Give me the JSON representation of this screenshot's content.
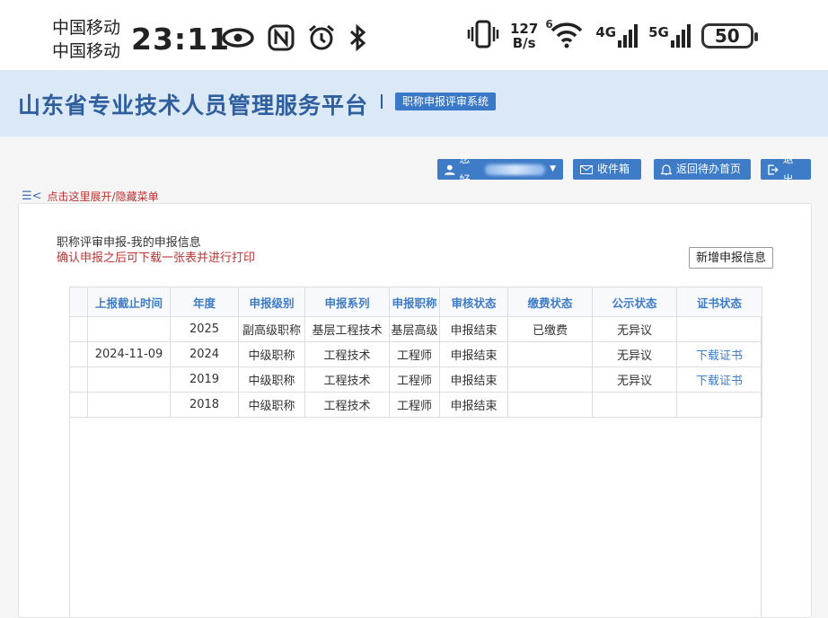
{
  "status_bar": {
    "carrier_1": "中国移动",
    "carrier_2": "中国移动",
    "time": "23:11",
    "speed_value": "127",
    "speed_unit": "B/s",
    "wifi_badge": "6",
    "net_1": "4G",
    "net_2": "5G",
    "battery": "50"
  },
  "header": {
    "title": "山东省专业技术人员管理服务平台",
    "system_badge": "职称申报评审系统"
  },
  "toolbar": {
    "user_label": "您好",
    "inbox_label": "收件箱",
    "todo_home_label": "返回待办首页",
    "logout_label": "退出",
    "toggle_menu_label": "点击这里展开/隐藏菜单",
    "toggle_menu_icon": "list-icon"
  },
  "main": {
    "info_title": "职称评审申报-我的申报信息",
    "info_note": "确认申报之后可下载一张表并进行打印",
    "add_button": "新增申报信息"
  },
  "table": {
    "headers": [
      "上报截止时间",
      "年度",
      "申报级别",
      "申报系列",
      "申报职称",
      "审核状态",
      "缴费状态",
      "公示状态",
      "证书状态"
    ],
    "rows": [
      [
        "",
        "2025",
        "副高级职称",
        "基层工程技术",
        "基层高级",
        "申报结束",
        "已缴费",
        "无异议",
        ""
      ],
      [
        "2024-11-09",
        "2024",
        "中级职称",
        "工程技术",
        "工程师",
        "申报结束",
        "",
        "无异议",
        "下载证书"
      ],
      [
        "",
        "2019",
        "中级职称",
        "工程技术",
        "工程师",
        "申报结束",
        "",
        "无异议",
        "下载证书"
      ],
      [
        "",
        "2018",
        "中级职称",
        "工程技术",
        "工程师",
        "申报结束",
        "",
        "",
        ""
      ]
    ]
  },
  "colors": {
    "accent": "#3f7cc7",
    "header_bg": "#dbe8f6",
    "title_color": "#2f5f9e",
    "warning_text": "#bb3333"
  }
}
